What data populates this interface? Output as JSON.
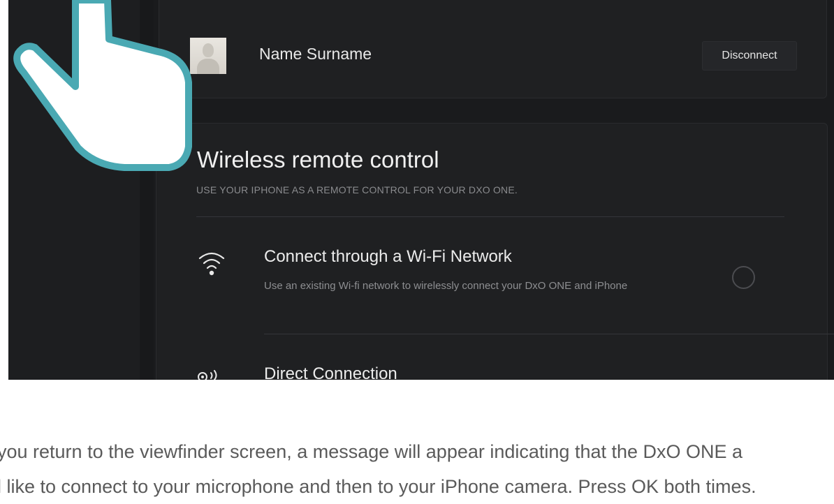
{
  "account": {
    "name": "Name Surname",
    "disconnect_label": "Disconnect"
  },
  "wireless": {
    "title": "Wireless remote control",
    "subtitle": "USE YOUR IPHONE AS A REMOTE CONTROL FOR YOUR DXO ONE.",
    "options": [
      {
        "icon": "wifi-icon",
        "title": "Connect through a Wi-Fi Network",
        "description": "Use an existing Wi-fi network to wirelessly connect your DxO ONE and iPhone"
      },
      {
        "icon": "direct-connection-icon",
        "title": "Direct Connection"
      }
    ]
  },
  "caption": {
    "line1": "you return to the viewfinder screen, a message will appear indicating that the DxO ONE a",
    "line2": "l like to connect to your microphone and then to your iPhone camera. Press OK both times."
  },
  "colors": {
    "hand_outline": "#4aa9b3",
    "panel_bg": "#1f2022",
    "text_muted": "#8a8b8e"
  }
}
